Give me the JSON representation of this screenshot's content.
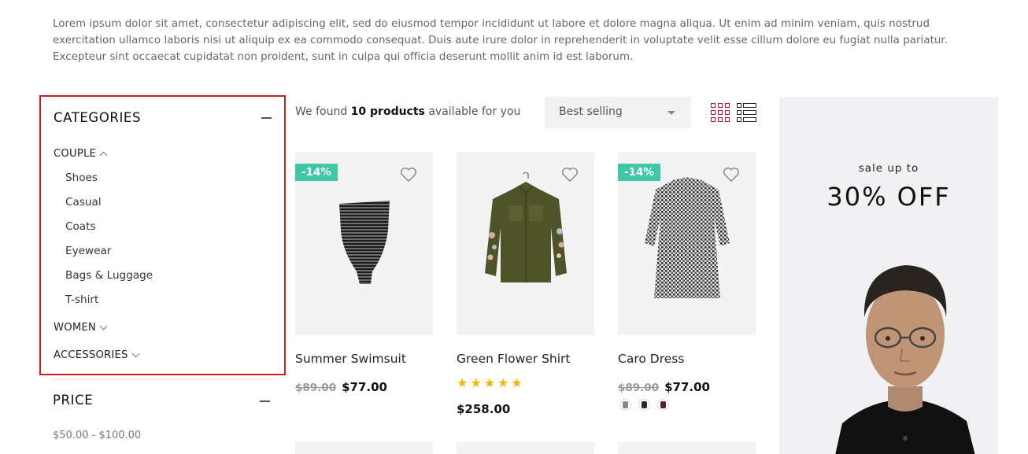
{
  "intro_text": "Lorem ipsum dolor sit amet, consectetur adipiscing elit, sed do eiusmod tempor incididunt ut labore et dolore magna aliqua. Ut enim ad minim veniam, quis nostrud exercitation ullamco laboris nisi ut aliquip ex ea commodo consequat. Duis aute irure dolor in reprehenderit in voluptate velit esse cillum dolore eu fugiat nulla pariatur. Excepteur sint occaecat cupidatat non proident, sunt in culpa qui officia deserunt mollit anim id est laborum.",
  "sidebar": {
    "categories_title": "CATEGORIES",
    "groups": [
      {
        "label": "COUPLE",
        "expanded": true,
        "items": [
          "Shoes",
          "Casual",
          "Coats",
          "Eyewear",
          "Bags & Luggage",
          "T-shirt"
        ]
      },
      {
        "label": "WOMEN",
        "expanded": false
      },
      {
        "label": "ACCESSORIES",
        "expanded": false
      }
    ],
    "price_title": "PRICE",
    "price_range": "$50.00 - $100.00"
  },
  "toolbar": {
    "found_prefix": "We found ",
    "found_count": "10 products",
    "found_suffix": " available for you",
    "sort_selected": "Best selling"
  },
  "products": [
    {
      "name": "Summer Swimsuit",
      "badge": "-14%",
      "old_price": "$89.00",
      "price": "$77.00"
    },
    {
      "name": "Green Flower Shirt",
      "rating": 5,
      "stars": "★★★★★",
      "price": "$258.00"
    },
    {
      "name": "Caro Dress",
      "badge": "-14%",
      "old_price": "$89.00",
      "price": "$77.00",
      "swatches": [
        "#8a8a8a",
        "#2a2a2a",
        "#5e1c2a"
      ]
    }
  ],
  "banner": {
    "subtitle": "sale up to",
    "headline": "30% OFF"
  },
  "colors": {
    "accent_red": "#c8102e",
    "badge_green": "#3ec8a9",
    "star_yellow": "#f5b800",
    "highlight_border": "#cc1f1f"
  }
}
